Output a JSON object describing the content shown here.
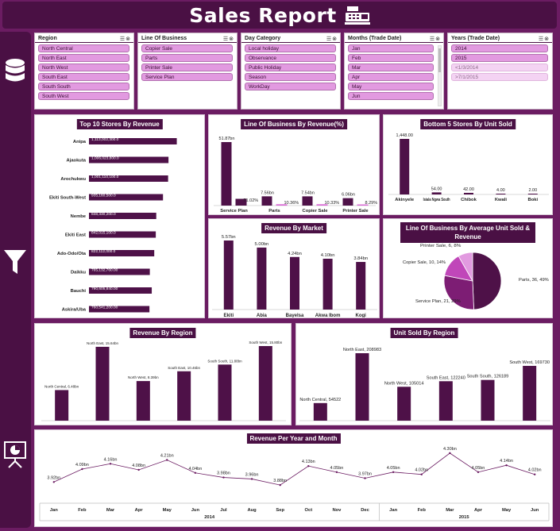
{
  "header": {
    "title": "Sales Report"
  },
  "icons": {
    "header": "cash-register-icon",
    "sidebar_top": "database-icon",
    "sidebar_mid": "filter-icon",
    "sidebar_bottom": "presentation-chart-icon"
  },
  "colors": {
    "bg": "#6b1c62",
    "dark": "#4a1044",
    "bar": "#4e1148",
    "pink": "#d966d4",
    "slicer": "#e29ae0"
  },
  "slicers": [
    {
      "title": "Region",
      "items": [
        "North Central",
        "North East",
        "North West",
        "South East",
        "South South",
        "South West"
      ],
      "dim": []
    },
    {
      "title": "Line Of Business",
      "items": [
        "Copier Sale",
        "Parts",
        "Printer Sale",
        "Service Plan"
      ],
      "dim": []
    },
    {
      "title": "Day Category",
      "items": [
        "Local holiday",
        "Observance",
        "Public Holiday",
        "Season",
        "WorkDay"
      ],
      "dim": []
    },
    {
      "title": "Months (Trade Date)",
      "items": [
        "Jan",
        "Feb",
        "Mar",
        "Apr",
        "May",
        "Jun"
      ],
      "dim": []
    },
    {
      "title": "Years (Trade Date)",
      "items": [
        "2014",
        "2015",
        "<1/3/2014",
        ">7/1/2015"
      ],
      "dim": [
        2,
        3
      ]
    }
  ],
  "chart_data": [
    {
      "id": "top10",
      "type": "bar",
      "orientation": "horizontal",
      "title": "Top 10 Stores By Revenue",
      "categories": [
        "Anipa",
        "Ajaokuta",
        "Arochukwu",
        "Ekiti South-West",
        "Nembe",
        "Ekiti East",
        "Ado-Odo/Ota",
        "Daikku",
        "Bauchi",
        "Askira/Uba"
      ],
      "values": [
        1113000000,
        1006000000,
        1001000000,
        935000000,
        848000000,
        842000000,
        822000000,
        765000000,
        790000000,
        760000000
      ],
      "labels": [
        "1,113,002,300.0",
        "1,006,023,800.0",
        "1,001,110,100.0",
        "935,160,500.0",
        "848,330,200.0",
        "842,015,100.0",
        "822,112,000.0",
        "765,132,760.00",
        "790,605,840.00",
        "760,541,200.00"
      ]
    },
    {
      "id": "lob",
      "type": "bar",
      "title": "Line Of Business By Revenue(%)",
      "categories": [
        "Service Plan",
        "Parts",
        "Copier Sale",
        "Printer Sale"
      ],
      "series": [
        {
          "values": [
            51.87,
            7.56,
            7.54,
            6.06
          ],
          "labels": [
            "51.87bn",
            "7.56bn",
            "7.54bn",
            "6.06bn"
          ]
        },
        {
          "values": [
            71.02,
            10.36,
            10.33,
            8.29
          ],
          "labels": [
            "71.02%",
            "10.36%",
            "10.33%",
            "8.29%"
          ]
        }
      ]
    },
    {
      "id": "bottom5",
      "type": "bar",
      "title": "Bottom 5 Stores By Unit Sold",
      "categories": [
        "Akinyele",
        "Isiala Ngwa South",
        "Chibok",
        "Kwali",
        "Boki"
      ],
      "values": [
        1448,
        54,
        42,
        4,
        2
      ],
      "labels": [
        "1,448.00",
        "54.00",
        "42.00",
        "4.00",
        "2.00"
      ]
    },
    {
      "id": "market",
      "type": "bar",
      "title": "Revenue By Market",
      "categories": [
        "Ekiti",
        "Abia",
        "Bayelsa",
        "Akwa Ibom",
        "Kogi"
      ],
      "values": [
        5.57,
        5.0,
        4.24,
        4.1,
        3.84
      ],
      "labels": [
        "5.57bn",
        "5.00bn",
        "4.24bn",
        "4.10bn",
        "3.84bn"
      ]
    },
    {
      "id": "pie",
      "type": "pie",
      "title": "Line Of Business By Average Unit Sold & Revenue",
      "categories": [
        "Parts",
        "Service Plan",
        "Copier Sale",
        "Printer Sale"
      ],
      "values": [
        36,
        21,
        10,
        6
      ],
      "percents": [
        49,
        29,
        14,
        8
      ],
      "labels": [
        "Parts, 36, 49%",
        "Service Plan, 21, 29%",
        "Copier Sale, 10, 14%",
        "Printer Sale, 6, 8%"
      ],
      "colors": [
        "#4e1148",
        "#7d1d74",
        "#c047b9",
        "#e29ae0"
      ]
    },
    {
      "id": "region_rev",
      "type": "bar",
      "title": "Revenue By Region",
      "categories": [
        "North Central",
        "North East",
        "North West",
        "South East",
        "South South",
        "South West"
      ],
      "values": [
        6.48,
        15.64,
        8.39,
        10.46,
        11.88,
        15.8
      ],
      "labels": [
        "North Central, 6.48bn",
        "North East, 15.64bn",
        "North West, 8.39bn",
        "South East, 10.46bn",
        "South South, 11.88bn",
        "South West, 15.80bn"
      ]
    },
    {
      "id": "region_units",
      "type": "bar",
      "title": "Unit Sold By Region",
      "categories": [
        "North Central",
        "North East",
        "North West",
        "South East",
        "South South",
        "South West"
      ],
      "values": [
        54522,
        208983,
        105014,
        122240,
        126189,
        169730
      ],
      "labels": [
        "North Central, 54522",
        "North East, 208983",
        "North West, 105014",
        "South East, 122240",
        "South South, 126189",
        "South West, 169730"
      ]
    },
    {
      "id": "monthly",
      "type": "line",
      "title": "Revenue Per Year and Month",
      "categories": [
        "Jan",
        "Feb",
        "Mar",
        "Apr",
        "May",
        "Jun",
        "Jul",
        "Aug",
        "Sep",
        "Oct",
        "Nov",
        "Dec",
        "Jan",
        "Feb",
        "Mar",
        "Apr",
        "May",
        "Jun"
      ],
      "groups": [
        {
          "label": "2014",
          "count": 12
        },
        {
          "label": "2015",
          "count": 6
        }
      ],
      "values": [
        3.92,
        4.09,
        4.16,
        4.08,
        4.21,
        4.04,
        3.98,
        3.96,
        3.88,
        4.13,
        4.05,
        3.97,
        4.05,
        4.02,
        4.3,
        4.05,
        4.14,
        4.02
      ],
      "labels": [
        "3.92bn",
        "4.09bn",
        "4.16bn",
        "4.08bn",
        "4.21bn",
        "4.04bn",
        "3.98bn",
        "3.96bn",
        "3.88bn",
        "4.13bn",
        "4.05bn",
        "3.97bn",
        "4.05bn",
        "4.02bn",
        "4.30bn",
        "4.05bn",
        "4.14bn",
        "4.02bn"
      ]
    }
  ]
}
